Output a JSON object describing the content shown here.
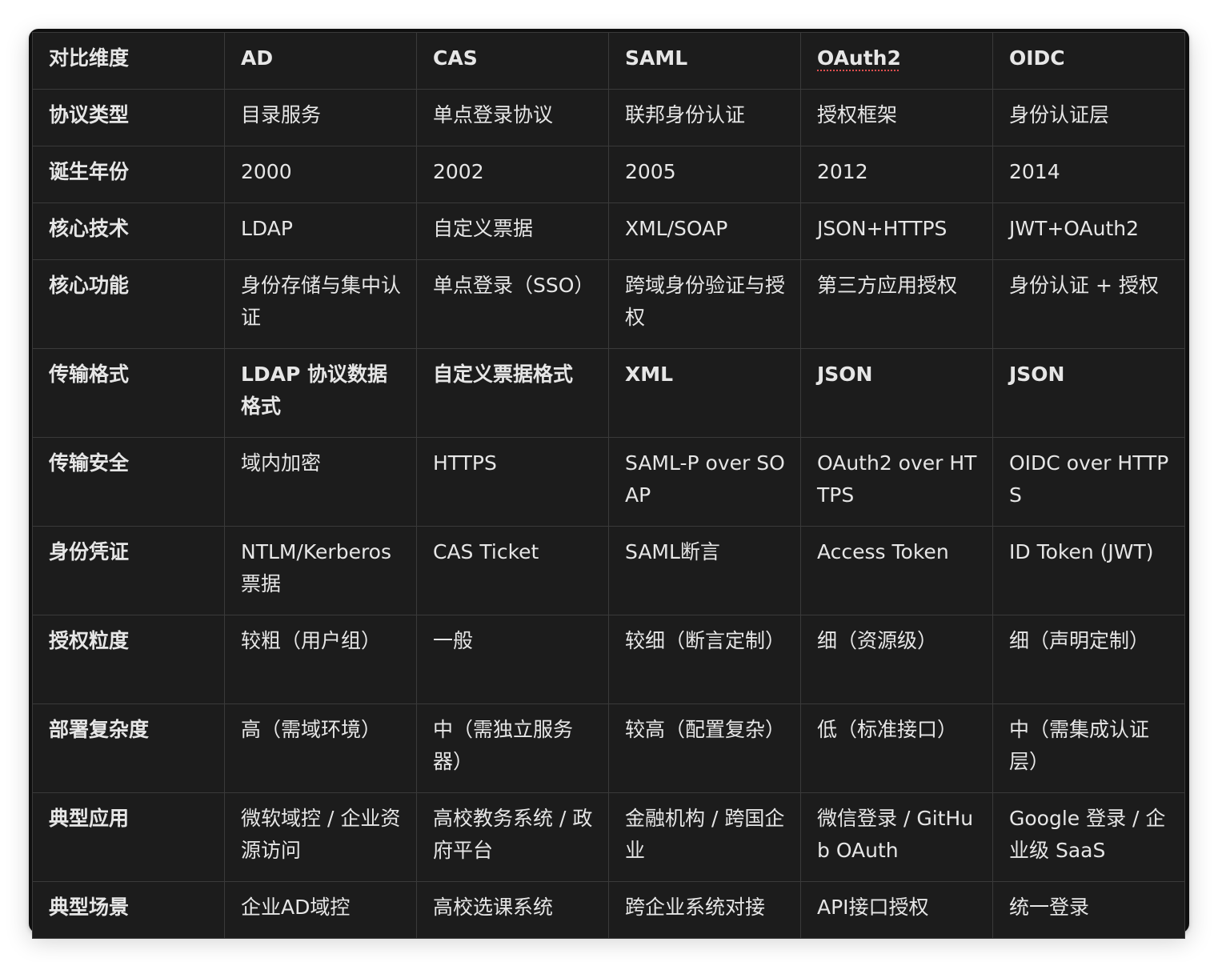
{
  "table": {
    "headers": [
      "对比维度",
      "AD",
      "CAS",
      "SAML",
      "OAuth2",
      "OIDC"
    ],
    "rows": [
      [
        "协议类型",
        "目录服务",
        "单点登录协议",
        "联邦身份认证",
        "授权框架",
        "身份认证层"
      ],
      [
        "诞生年份",
        "2000",
        "2002",
        "2005",
        "2012",
        "2014"
      ],
      [
        "核心技术",
        "LDAP",
        "自定义票据",
        "XML/SOAP",
        "JSON+HTTPS",
        "JWT+OAuth2"
      ],
      [
        "核心功能",
        "身份存储与集中认证",
        "单点登录（SSO）",
        "跨域身份验证与授权",
        "第三方应用授权",
        "身份认证 + 授权"
      ],
      [
        "传输格式",
        "LDAP 协议数据格式",
        "自定义票据格式",
        "XML",
        "JSON",
        "JSON"
      ],
      [
        "传输安全",
        "域内加密",
        "HTTPS",
        "SAML-P over SOAP",
        "OAuth2 over HTTPS",
        "OIDC over HTTPS"
      ],
      [
        "身份凭证",
        "NTLM/Kerberos票据",
        "CAS Ticket",
        "SAML断言",
        "Access Token",
        "ID Token (JWT)"
      ],
      [
        "授权粒度",
        "较粗（用户组）",
        "一般",
        "较细（断言定制）",
        "细（资源级）",
        "细（声明定制）"
      ],
      [
        "部署复杂度",
        "高（需域环境）",
        "中（需独立服务器）",
        "较高（配置复杂）",
        "低（标准接口）",
        "中（需集成认证层）"
      ],
      [
        "典型应用",
        "微软域控 / 企业资源访问",
        "高校教务系统 / 政府平台",
        "金融机构 / 跨国企业",
        "微信登录 / GitHub OAuth",
        "Google 登录 / 企业级 SaaS"
      ],
      [
        "典型场景",
        "企业AD域控",
        "高校选课系统",
        "跨企业系统对接",
        "API接口授权",
        "统一登录"
      ]
    ]
  }
}
